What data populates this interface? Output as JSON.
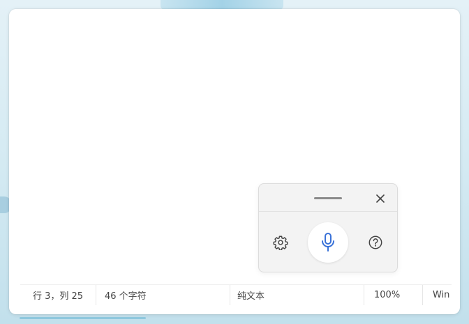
{
  "status_bar": {
    "position": "行 3，列 25",
    "char_count": "46 个字符",
    "format": "纯文本",
    "zoom": "100%",
    "line_ending": "Win"
  },
  "voice_typing": {
    "close_glyph": "✕",
    "accent_color": "#3a72d8",
    "icons": [
      "gear-icon",
      "microphone-icon",
      "help-icon",
      "close-icon"
    ]
  }
}
